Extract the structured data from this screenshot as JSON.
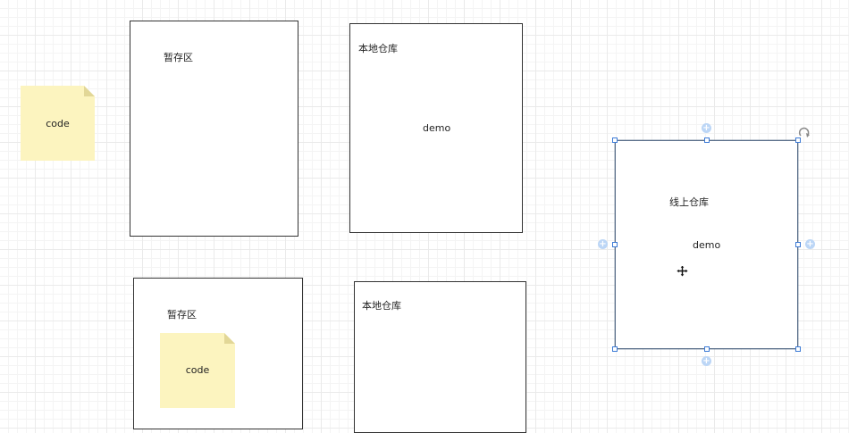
{
  "note_top": {
    "text": "code",
    "color": "#fcf4bf",
    "fold_color": "#e6dc98"
  },
  "staging_top": {
    "label": "暂存区"
  },
  "local_repo_top": {
    "label": "本地仓库",
    "content": "demo"
  },
  "remote_repo": {
    "label": "线上仓库",
    "content": "demo",
    "selection_color": "#3d7bd6"
  },
  "staging_bottom": {
    "label": "暂存区",
    "note_text": "code"
  },
  "local_repo_bottom": {
    "label": "本地仓库"
  },
  "icons": [
    "rotate-icon",
    "move-cursor-icon",
    "connect-plus-icon"
  ]
}
